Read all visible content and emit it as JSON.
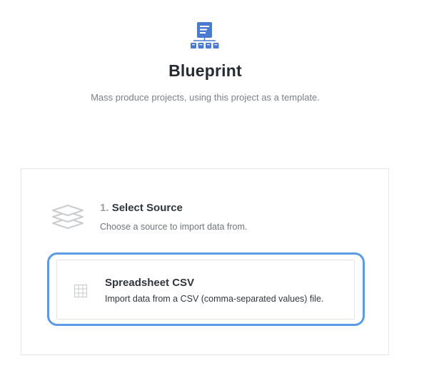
{
  "header": {
    "icon": "blueprint-icon",
    "title": "Blueprint",
    "subtitle": "Mass produce projects, using this project as a template."
  },
  "step": {
    "icon": "layers-icon",
    "number": "1.",
    "title": "Select Source",
    "description": "Choose a source to import data from."
  },
  "sources": [
    {
      "icon": "table-grid-icon",
      "title": "Spreadsheet CSV",
      "description": "Import data from a CSV (comma-separated values) file."
    }
  ],
  "colors": {
    "accent": "#5b9ae6",
    "logo_blue": "#4a7bd0",
    "text_dark": "#262b33",
    "text_muted": "#7b8088"
  }
}
